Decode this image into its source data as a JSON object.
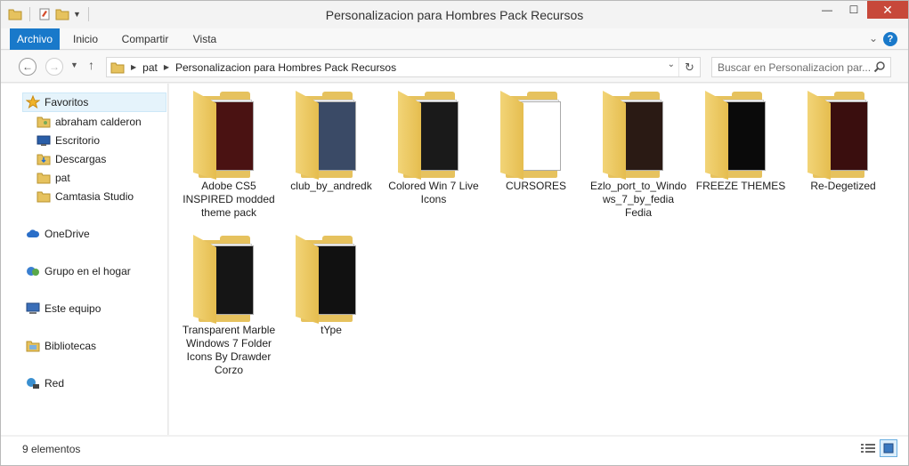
{
  "window": {
    "title": "Personalizacion para Hombres Pack Recursos",
    "minimize": "—",
    "maximize": "☐",
    "close": "✕"
  },
  "ribbon": {
    "tabs": [
      {
        "label": "Archivo"
      },
      {
        "label": "Inicio"
      },
      {
        "label": "Compartir"
      },
      {
        "label": "Vista"
      }
    ],
    "help": "?"
  },
  "address": {
    "crumbs": [
      "pat",
      "Personalizacion para Hombres Pack Recursos"
    ]
  },
  "search": {
    "placeholder": "Buscar en Personalizacion par..."
  },
  "nav": {
    "favorites": "Favoritos",
    "favorite_items": [
      {
        "label": "abraham calderon"
      },
      {
        "label": "Escritorio"
      },
      {
        "label": "Descargas"
      },
      {
        "label": "pat"
      },
      {
        "label": "Camtasia Studio"
      }
    ],
    "sections": [
      {
        "label": "OneDrive"
      },
      {
        "label": "Grupo en el hogar"
      },
      {
        "label": "Este equipo"
      },
      {
        "label": "Bibliotecas"
      },
      {
        "label": "Red"
      }
    ]
  },
  "files": [
    {
      "label": "Adobe CS5 INSPIRED modded theme pack",
      "thumb": "#4a1212"
    },
    {
      "label": "club_by_andredk",
      "thumb": "#3a4a66"
    },
    {
      "label": "Colored Win 7 Live Icons",
      "thumb": "#1a1a1a"
    },
    {
      "label": "CURSORES",
      "thumb": "#ffffff"
    },
    {
      "label": "Ezlo_port_to_Windows_7_by_fedia Fedia",
      "thumb": "#2a1a14"
    },
    {
      "label": "FREEZE  THEMES",
      "thumb": "#0a0a0a"
    },
    {
      "label": "Re-Degetized",
      "thumb": "#3a0e0e"
    },
    {
      "label": "Transparent Marble Windows 7 Folder Icons By Drawder Corzo",
      "thumb": "#151515"
    },
    {
      "label": "tYpe",
      "thumb": "#111111"
    }
  ],
  "status": {
    "count": "9 elementos"
  },
  "colors": {
    "accent": "#1979ca",
    "folder": "#e6c25e",
    "close": "#c7483a"
  }
}
